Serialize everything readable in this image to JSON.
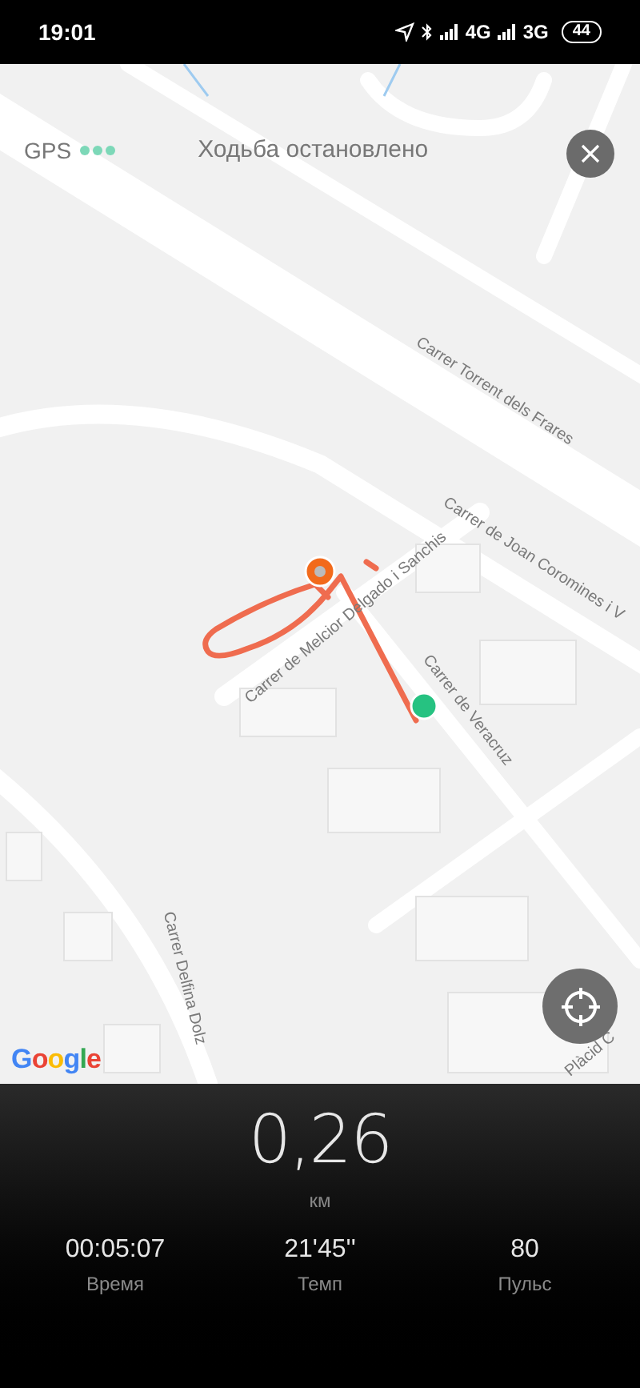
{
  "status_bar": {
    "time": "19:01",
    "network_1": "4G",
    "network_2": "3G",
    "battery": "44"
  },
  "header": {
    "gps_label": "GPS",
    "status": "Ходьба остановлено"
  },
  "map": {
    "street_labels": [
      {
        "text": "Carrer Torrent dels Frares",
        "kind": "down"
      },
      {
        "text": "Carrer de Joan Coromines i V",
        "kind": "down"
      },
      {
        "text": "Carrer de Melcior Delgado i Sanchis",
        "kind": "up"
      },
      {
        "text": "Carrer de Veracruz",
        "kind": "steep"
      },
      {
        "text": "Carrer Delfina Dolz",
        "kind": "vertical"
      },
      {
        "text": "Plàcid C",
        "kind": "up"
      }
    ],
    "attribution": "Google"
  },
  "stats": {
    "distance": {
      "value": "0,26",
      "unit": "км"
    },
    "metrics": [
      {
        "value": "00:05:07",
        "label": "Время"
      },
      {
        "value": "21'45''",
        "label": "Темп"
      },
      {
        "value": "80",
        "label": "Пульс"
      }
    ]
  }
}
